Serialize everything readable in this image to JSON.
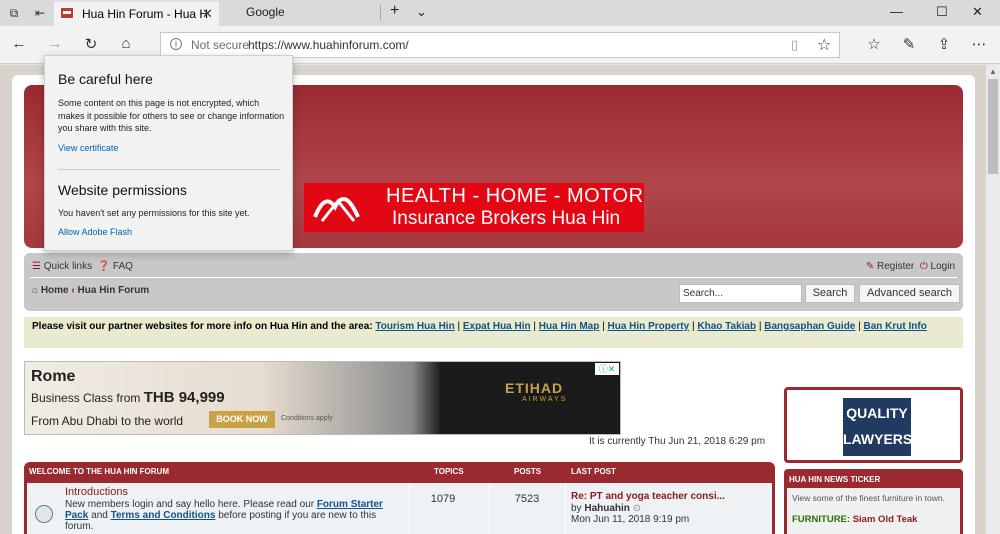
{
  "browser": {
    "active_tab_title": "Hua Hin Forum - Hua H",
    "second_tab_title": "Google",
    "address": {
      "security_label": "Not secure",
      "url": "https://www.huahinforum.com/"
    }
  },
  "popup": {
    "title": "Be careful here",
    "message": "Some content on this page is not encrypted, which makes it possible for others to see or change information you share with this site.",
    "view_certificate": "View certificate",
    "permissions_title": "Website permissions",
    "permissions_message": "You haven't set any permissions for this site yet.",
    "allow_flash": "Allow Adobe Flash"
  },
  "banner": {
    "line1": "HEALTH - HOME - MOTOR",
    "line2": "Insurance Brokers Hua Hin"
  },
  "nav": {
    "quick_links": "Quick links",
    "faq": "FAQ",
    "register": "Register",
    "login": "Login",
    "crumb_home": "Home",
    "crumb_forum": "Hua Hin Forum",
    "search_placeholder": "Search...",
    "search_button": "Search",
    "advanced_search": "Advanced search"
  },
  "partners": {
    "intro": "Please visit our partner websites for more info on Hua Hin and the area:",
    "links": [
      "Tourism Hua Hin",
      "Expat Hua Hin",
      "Hua Hin Map",
      "Hua Hin Property",
      "Khao Takiab",
      "Bangsaphan Guide",
      "Ban Krut Info"
    ]
  },
  "ad": {
    "destination": "Rome",
    "class_text": "Business Class from",
    "price": "THB 94,999",
    "from_text": "From Abu Dhabi to the world",
    "book_now": "BOOK NOW",
    "conditions": "Conditions apply",
    "brand": "ETIHAD",
    "brand_sub": "AIRWAYS"
  },
  "current_time": "It is currently Thu Jun 21, 2018 6:29 pm",
  "forum_table": {
    "headers": {
      "section": "WELCOME TO THE HUA HIN FORUM",
      "topics": "TOPICS",
      "posts": "POSTS",
      "last_post": "LAST POST"
    },
    "rows": [
      {
        "title": "Introductions",
        "desc_pre": "New members login and say hello here. Please read our",
        "link1": "Forum Starter Pack",
        "desc_mid": "and",
        "link2": "Terms and Conditions",
        "desc_post": "before posting if you are new to this forum.",
        "topics": "1079",
        "posts": "7523",
        "last_post_title": "Re: PT and yoga teacher consi...",
        "last_post_by_label": "by",
        "last_post_author": "Hahuahin",
        "last_post_date": "Mon Jun 11, 2018 9:19 pm"
      }
    ]
  },
  "sidebar": {
    "lawyers_line1": "QUALITY",
    "lawyers_line2": "LAWYERS",
    "ticker_title": "HUA HIN NEWS TICKER",
    "ticker_text": "View some of the finest furniture in town.",
    "ticker_label": "FURNITURE:",
    "ticker_value": "Siam Old Teak"
  },
  "colors": {
    "header_red": "#9b2a30",
    "banner_red": "#e30613",
    "link_blue": "#105289"
  }
}
